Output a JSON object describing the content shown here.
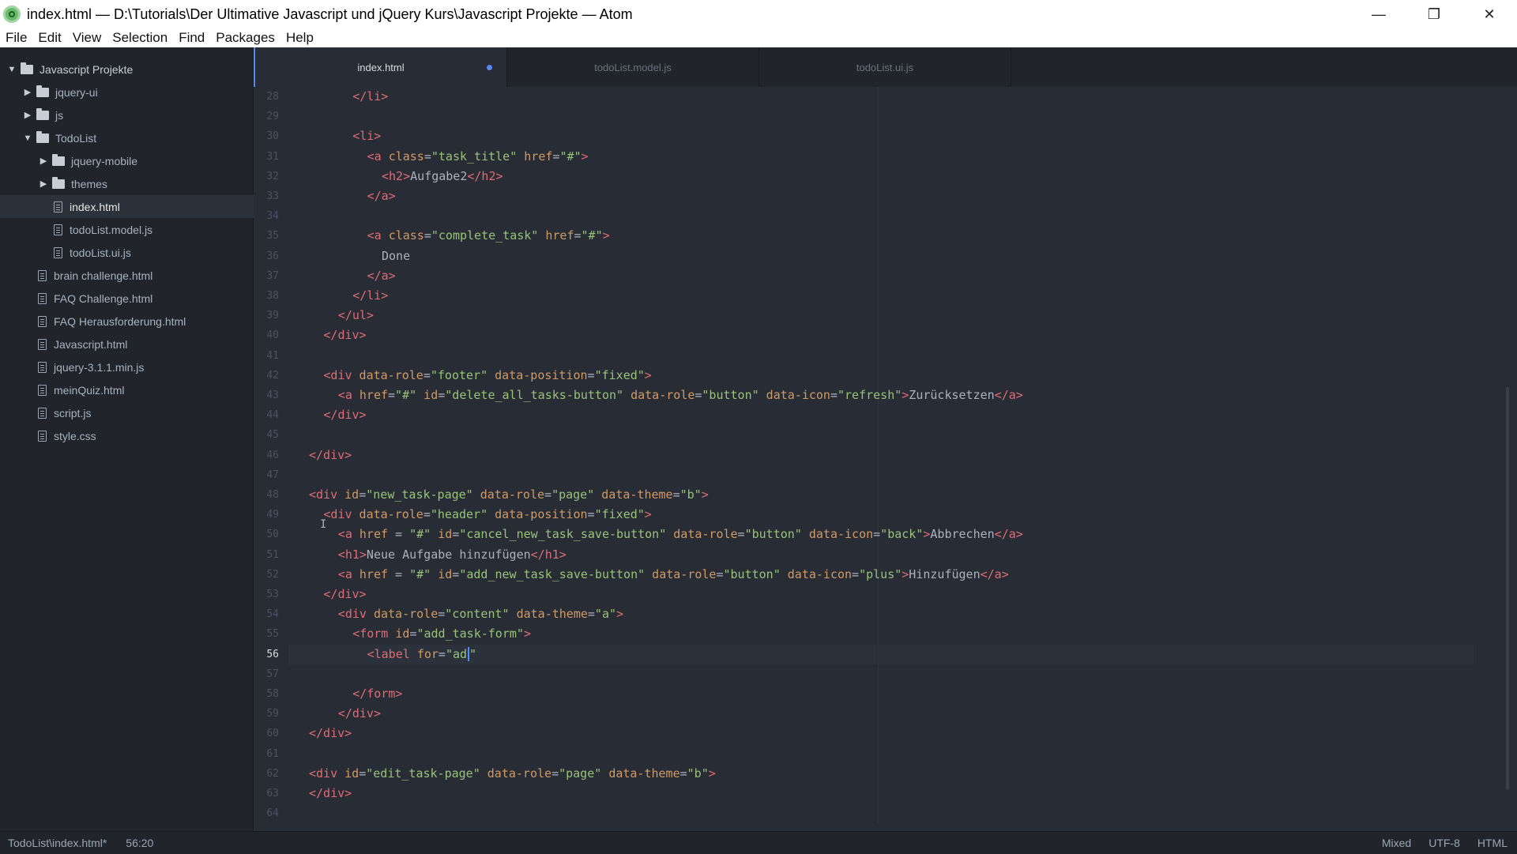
{
  "window": {
    "title": "index.html — D:\\Tutorials\\Der Ultimative Javascript und jQuery Kurs\\Javascript Projekte — Atom",
    "controls": [
      "—",
      "❐",
      "✕"
    ]
  },
  "menu": [
    "File",
    "Edit",
    "View",
    "Selection",
    "Find",
    "Packages",
    "Help"
  ],
  "tree": {
    "root": "Javascript Projekte",
    "items": [
      {
        "label": "jquery-ui",
        "type": "folder",
        "depth": 1,
        "expanded": false
      },
      {
        "label": "js",
        "type": "folder",
        "depth": 1,
        "expanded": false
      },
      {
        "label": "TodoList",
        "type": "folder",
        "depth": 1,
        "expanded": true
      },
      {
        "label": "jquery-mobile",
        "type": "folder",
        "depth": 2,
        "expanded": false
      },
      {
        "label": "themes",
        "type": "folder",
        "depth": 2,
        "expanded": false
      },
      {
        "label": "index.html",
        "type": "file",
        "depth": 2,
        "selected": true
      },
      {
        "label": "todoList.model.js",
        "type": "file",
        "depth": 2
      },
      {
        "label": "todoList.ui.js",
        "type": "file",
        "depth": 2
      },
      {
        "label": "brain challenge.html",
        "type": "file",
        "depth": 1
      },
      {
        "label": "FAQ Challenge.html",
        "type": "file",
        "depth": 1
      },
      {
        "label": "FAQ Herausforderung.html",
        "type": "file",
        "depth": 1
      },
      {
        "label": "Javascript.html",
        "type": "file",
        "depth": 1
      },
      {
        "label": "jquery-3.1.1.min.js",
        "type": "file",
        "depth": 1
      },
      {
        "label": "meinQuiz.html",
        "type": "file",
        "depth": 1
      },
      {
        "label": "script.js",
        "type": "file",
        "depth": 1
      },
      {
        "label": "style.css",
        "type": "file",
        "depth": 1
      }
    ]
  },
  "tabs": [
    {
      "label": "index.html",
      "active": true,
      "modified": true
    },
    {
      "label": "todoList.model.js",
      "active": false
    },
    {
      "label": "todoList.ui.js",
      "active": false
    }
  ],
  "editor": {
    "current_line": 56,
    "lines": [
      {
        "n": "28",
        "i": 3,
        "t": [
          [
            "tg",
            "</li>"
          ]
        ]
      },
      {
        "n": "29",
        "i": 0,
        "t": []
      },
      {
        "n": "30",
        "i": 3,
        "t": [
          [
            "tg",
            "<li>"
          ]
        ]
      },
      {
        "n": "31",
        "i": 4,
        "t": [
          [
            "tg",
            "<a "
          ],
          [
            "at",
            "class"
          ],
          [
            "tx",
            "="
          ],
          [
            "st",
            "\"task_title\""
          ],
          [
            "tx",
            " "
          ],
          [
            "at",
            "href"
          ],
          [
            "tx",
            "="
          ],
          [
            "st",
            "\"#\""
          ],
          [
            "tg",
            ">"
          ]
        ]
      },
      {
        "n": "32",
        "i": 5,
        "t": [
          [
            "tg",
            "<h2>"
          ],
          [
            "tx",
            "Aufgabe2"
          ],
          [
            "tg",
            "</h2>"
          ]
        ]
      },
      {
        "n": "33",
        "i": 4,
        "t": [
          [
            "tg",
            "</a>"
          ]
        ]
      },
      {
        "n": "34",
        "i": 0,
        "t": []
      },
      {
        "n": "35",
        "i": 4,
        "t": [
          [
            "tg",
            "<a "
          ],
          [
            "at",
            "class"
          ],
          [
            "tx",
            "="
          ],
          [
            "st",
            "\"complete_task\""
          ],
          [
            "tx",
            " "
          ],
          [
            "at",
            "href"
          ],
          [
            "tx",
            "="
          ],
          [
            "st",
            "\"#\""
          ],
          [
            "tg",
            ">"
          ]
        ]
      },
      {
        "n": "36",
        "i": 5,
        "t": [
          [
            "tx",
            "Done"
          ]
        ]
      },
      {
        "n": "37",
        "i": 4,
        "t": [
          [
            "tg",
            "</a>"
          ]
        ]
      },
      {
        "n": "38",
        "i": 3,
        "t": [
          [
            "tg",
            "</li>"
          ]
        ]
      },
      {
        "n": "39",
        "i": 2,
        "t": [
          [
            "tg",
            "</ul>"
          ]
        ]
      },
      {
        "n": "40",
        "i": 1,
        "t": [
          [
            "tg",
            "</div>"
          ]
        ]
      },
      {
        "n": "41",
        "i": 0,
        "t": []
      },
      {
        "n": "42",
        "i": 1,
        "t": [
          [
            "tg",
            "<div "
          ],
          [
            "at",
            "data-role"
          ],
          [
            "tx",
            "="
          ],
          [
            "st",
            "\"footer\""
          ],
          [
            "tx",
            " "
          ],
          [
            "at",
            "data-position"
          ],
          [
            "tx",
            "="
          ],
          [
            "st",
            "\"fixed\""
          ],
          [
            "tg",
            ">"
          ]
        ]
      },
      {
        "n": "43",
        "i": 2,
        "t": [
          [
            "tg",
            "<a "
          ],
          [
            "at",
            "href"
          ],
          [
            "tx",
            "="
          ],
          [
            "st",
            "\"#\""
          ],
          [
            "tx",
            " "
          ],
          [
            "at",
            "id"
          ],
          [
            "tx",
            "="
          ],
          [
            "st",
            "\"delete_all_tasks-button\""
          ],
          [
            "tx",
            " "
          ],
          [
            "at",
            "data-role"
          ],
          [
            "tx",
            "="
          ],
          [
            "st",
            "\"button\""
          ],
          [
            "tx",
            " "
          ],
          [
            "at",
            "data-icon"
          ],
          [
            "tx",
            "="
          ],
          [
            "st",
            "\"refresh\""
          ],
          [
            "tg",
            ">"
          ],
          [
            "tx",
            "Zurücksetzen"
          ],
          [
            "tg",
            "</a>"
          ]
        ]
      },
      {
        "n": "44",
        "i": 1,
        "t": [
          [
            "tg",
            "</div>"
          ]
        ]
      },
      {
        "n": "45",
        "i": 0,
        "t": []
      },
      {
        "n": "46",
        "i": 0,
        "t": [
          [
            "tg",
            "</div>"
          ]
        ]
      },
      {
        "n": "47",
        "i": 0,
        "t": []
      },
      {
        "n": "48",
        "i": 0,
        "t": [
          [
            "tg",
            "<div "
          ],
          [
            "at",
            "id"
          ],
          [
            "tx",
            "="
          ],
          [
            "st",
            "\"new_task-page\""
          ],
          [
            "tx",
            " "
          ],
          [
            "at",
            "data-role"
          ],
          [
            "tx",
            "="
          ],
          [
            "st",
            "\"page\""
          ],
          [
            "tx",
            " "
          ],
          [
            "at",
            "data-theme"
          ],
          [
            "tx",
            "="
          ],
          [
            "st",
            "\"b\""
          ],
          [
            "tg",
            ">"
          ]
        ]
      },
      {
        "n": "49",
        "i": 1,
        "t": [
          [
            "tg",
            "<div "
          ],
          [
            "at",
            "data-role"
          ],
          [
            "tx",
            "="
          ],
          [
            "st",
            "\"header\""
          ],
          [
            "tx",
            " "
          ],
          [
            "at",
            "data-position"
          ],
          [
            "tx",
            "="
          ],
          [
            "st",
            "\"fixed\""
          ],
          [
            "tg",
            ">"
          ]
        ]
      },
      {
        "n": "50",
        "i": 2,
        "t": [
          [
            "tg",
            "<a "
          ],
          [
            "at",
            "href"
          ],
          [
            "tx",
            " = "
          ],
          [
            "st",
            "\"#\""
          ],
          [
            "tx",
            " "
          ],
          [
            "at",
            "id"
          ],
          [
            "tx",
            "="
          ],
          [
            "st",
            "\"cancel_new_task_save-button\""
          ],
          [
            "tx",
            " "
          ],
          [
            "at",
            "data-role"
          ],
          [
            "tx",
            "="
          ],
          [
            "st",
            "\"button\""
          ],
          [
            "tx",
            " "
          ],
          [
            "at",
            "data-icon"
          ],
          [
            "tx",
            "="
          ],
          [
            "st",
            "\"back\""
          ],
          [
            "tg",
            ">"
          ],
          [
            "tx",
            "Abbrechen"
          ],
          [
            "tg",
            "</a>"
          ]
        ]
      },
      {
        "n": "51",
        "i": 2,
        "t": [
          [
            "tg",
            "<h1>"
          ],
          [
            "tx",
            "Neue Aufgabe hinzufügen"
          ],
          [
            "tg",
            "</h1>"
          ]
        ]
      },
      {
        "n": "52",
        "i": 2,
        "t": [
          [
            "tg",
            "<a "
          ],
          [
            "at",
            "href"
          ],
          [
            "tx",
            " = "
          ],
          [
            "st",
            "\"#\""
          ],
          [
            "tx",
            " "
          ],
          [
            "at",
            "id"
          ],
          [
            "tx",
            "="
          ],
          [
            "st",
            "\"add_new_task_save-button\""
          ],
          [
            "tx",
            " "
          ],
          [
            "at",
            "data-role"
          ],
          [
            "tx",
            "="
          ],
          [
            "st",
            "\"button\""
          ],
          [
            "tx",
            " "
          ],
          [
            "at",
            "data-icon"
          ],
          [
            "tx",
            "="
          ],
          [
            "st",
            "\"plus\""
          ],
          [
            "tg",
            ">"
          ],
          [
            "tx",
            "Hinzufügen"
          ],
          [
            "tg",
            "</a>"
          ]
        ]
      },
      {
        "n": "53",
        "i": 1,
        "t": [
          [
            "tg",
            "</div>"
          ]
        ]
      },
      {
        "n": "54",
        "i": 2,
        "t": [
          [
            "tg",
            "<div "
          ],
          [
            "at",
            "data-role"
          ],
          [
            "tx",
            "="
          ],
          [
            "st",
            "\"content\""
          ],
          [
            "tx",
            " "
          ],
          [
            "at",
            "data-theme"
          ],
          [
            "tx",
            "="
          ],
          [
            "st",
            "\"a\""
          ],
          [
            "tg",
            ">"
          ]
        ]
      },
      {
        "n": "55",
        "i": 3,
        "t": [
          [
            "tg",
            "<form "
          ],
          [
            "at",
            "id"
          ],
          [
            "tx",
            "="
          ],
          [
            "st",
            "\"add_task-form\""
          ],
          [
            "tg",
            ">"
          ]
        ]
      },
      {
        "n": "56",
        "i": 4,
        "t": [
          [
            "tg",
            "<label "
          ],
          [
            "at",
            "for"
          ],
          [
            "tx",
            "="
          ],
          [
            "st",
            "\"ad\""
          ]
        ]
      },
      {
        "n": "57",
        "i": 0,
        "t": []
      },
      {
        "n": "58",
        "i": 3,
        "t": [
          [
            "tg",
            "</form>"
          ]
        ]
      },
      {
        "n": "59",
        "i": 2,
        "t": [
          [
            "tg",
            "</div>"
          ]
        ]
      },
      {
        "n": "60",
        "i": 0,
        "t": [
          [
            "tg",
            "</div>"
          ]
        ]
      },
      {
        "n": "61",
        "i": 0,
        "t": []
      },
      {
        "n": "62",
        "i": 0,
        "t": [
          [
            "tg",
            "<div "
          ],
          [
            "at",
            "id"
          ],
          [
            "tx",
            "="
          ],
          [
            "st",
            "\"edit_task-page\""
          ],
          [
            "tx",
            " "
          ],
          [
            "at",
            "data-role"
          ],
          [
            "tx",
            "="
          ],
          [
            "st",
            "\"page\""
          ],
          [
            "tx",
            " "
          ],
          [
            "at",
            "data-theme"
          ],
          [
            "tx",
            "="
          ],
          [
            "st",
            "\"b\""
          ],
          [
            "tg",
            ">"
          ]
        ]
      },
      {
        "n": "63",
        "i": 0,
        "t": [
          [
            "tg",
            "</div>"
          ]
        ]
      },
      {
        "n": "64",
        "i": 0,
        "t": []
      }
    ]
  },
  "status": {
    "file": "TodoList\\index.html*",
    "position": "56:20",
    "line_ending": "Mixed",
    "encoding": "UTF-8",
    "grammar": "HTML"
  },
  "colors": {
    "accent": "#568af2",
    "tag": "#e06c75",
    "attribute": "#d19a66",
    "string": "#98c379",
    "text": "#abb2bf"
  }
}
